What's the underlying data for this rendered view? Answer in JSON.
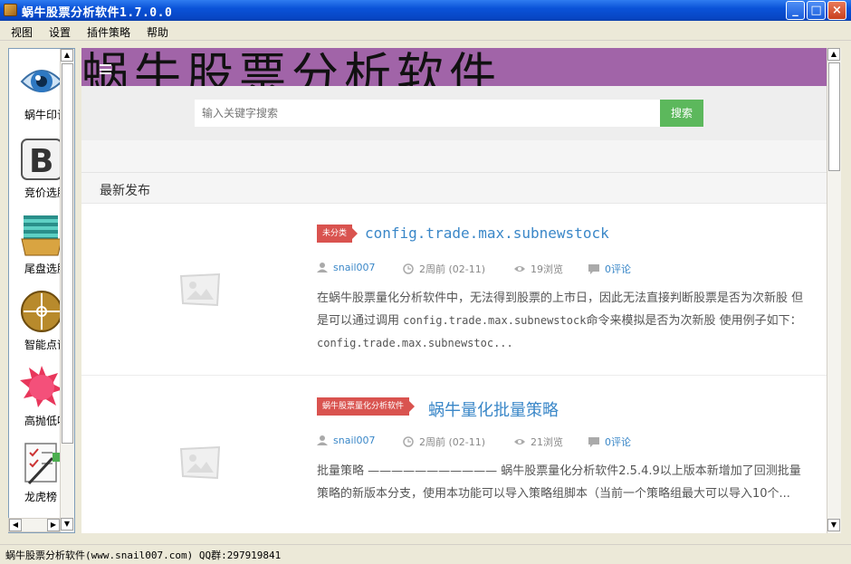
{
  "window": {
    "title": "蜗牛股票分析软件1.7.0.0",
    "controls": {
      "minimize": "_",
      "maximize": "□",
      "close": "×"
    }
  },
  "menu": [
    "视图",
    "设置",
    "插件策略",
    "帮助"
  ],
  "toolbar": {
    "items": [
      {
        "label": "蜗牛印记",
        "icon": "eye-icon"
      },
      {
        "label": "竞价选股",
        "icon": "b-letter-icon"
      },
      {
        "label": "尾盘选股",
        "icon": "folder-stack-icon"
      },
      {
        "label": "智能点评",
        "icon": "crosshair-icon"
      },
      {
        "label": "高抛低吸",
        "icon": "star-burst-icon"
      },
      {
        "label": "龙虎榜",
        "icon": "checklist-pen-icon"
      }
    ]
  },
  "site": {
    "banner_text": "蜗牛股票分析软件",
    "search_placeholder": "输入关键字搜索",
    "search_button": "搜索",
    "section_title": "最新发布"
  },
  "articles": [
    {
      "tag": "未分类",
      "title": "config.trade.max.subnewstock",
      "author": "snail007",
      "time": "2周前 (02-11)",
      "views": "19浏览",
      "comments": "0评论",
      "excerpt_1": "在蜗牛股票量化分析软件中，无法得到股票的上市日，因此无法直接判断股票是否为次新股 但是可以通过调用 ",
      "excerpt_code": "config.trade.max.subnewstock",
      "excerpt_2": "命令来模拟是否为次新股 使用例子如下： ",
      "excerpt_code2": "config.trade.max.subnewstoc..."
    },
    {
      "tag": "蜗牛股票量化分析软件",
      "title": "蜗牛量化批量策略",
      "author": "snail007",
      "time": "2周前 (02-11)",
      "views": "21浏览",
      "comments": "0评论",
      "excerpt_1": "批量策略 ——————————— 蜗牛股票量化分析软件2.5.4.9以上版本新增加了回测批量策略的新版本分支，使用本功能可以导入策略组脚本（当前一个策略组最大可以导入10个...",
      "excerpt_code": "",
      "excerpt_2": "",
      "excerpt_code2": ""
    }
  ],
  "status": "蜗牛股票分析软件(www.snail007.com) QQ群:297919841"
}
